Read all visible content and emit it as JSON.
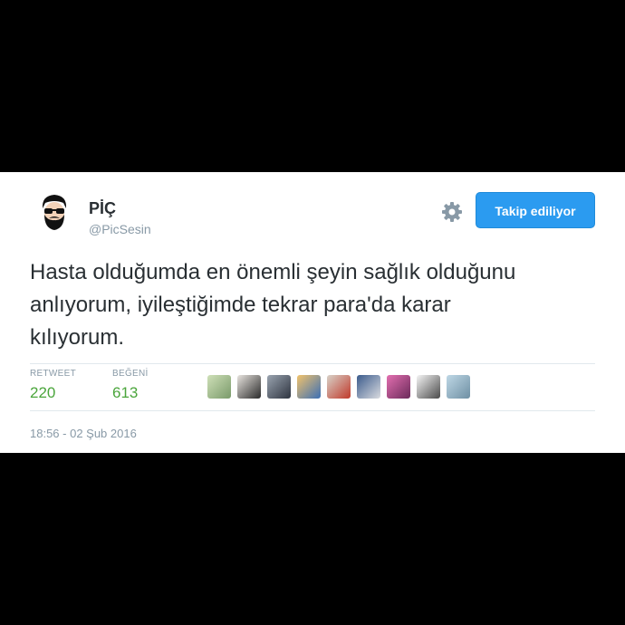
{
  "tweet": {
    "author": {
      "name": "PİÇ",
      "handle": "@PicSesin",
      "avatar_icon": "bearded-man-sunglasses-avatar"
    },
    "settings_icon": "gear-icon",
    "follow_button_label": "Takip ediliyor",
    "text": "Hasta olduğumda en önemli şeyin sağlık olduğunu anlıyorum, iyileştiğimde tekrar para'da karar kılıyorum.",
    "stats": {
      "retweet_label": "RETWEET",
      "retweet_count": "220",
      "like_label": "BEĞENİ",
      "like_count": "613"
    },
    "likers_count_shown": 9,
    "timestamp": "18:56 - 02 Şub 2016"
  },
  "colors": {
    "page_background": "#000000",
    "card_background": "#ffffff",
    "follow_button": "#2b9bf0",
    "stat_value": "#4aa53b",
    "secondary_text": "#8899a6",
    "primary_text": "#292f33"
  }
}
